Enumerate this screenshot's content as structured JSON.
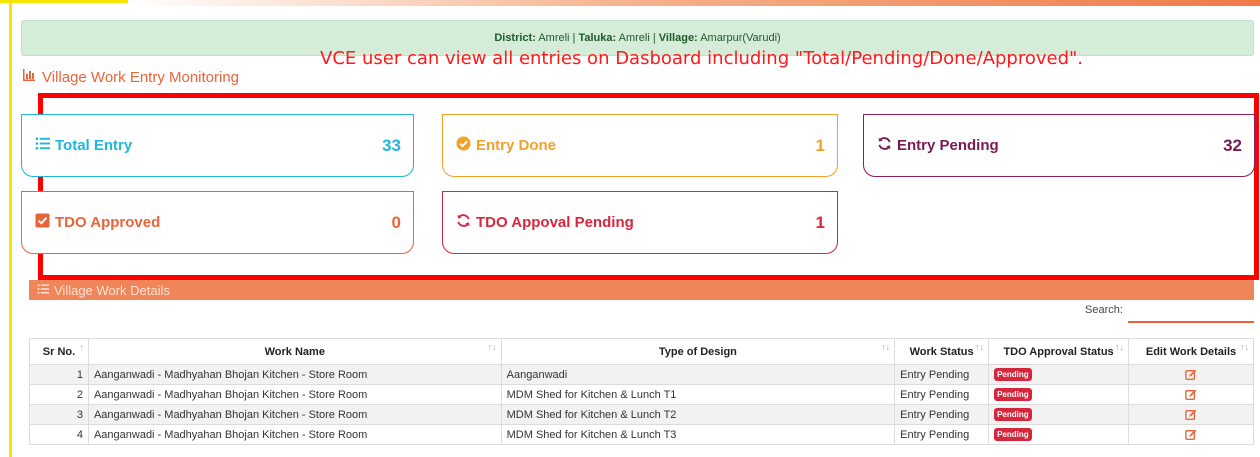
{
  "location": {
    "district_label": "District:",
    "district": "Amreli",
    "taluka_label": "Taluka:",
    "taluka": "Amreli",
    "village_label": "Village:",
    "village": "Amarpur(Varudi)",
    "separator": " | "
  },
  "annotation_text": "VCE user can view all entries on Dasboard including \"Total/Pending/Done/Approved\".",
  "page_title": "Village Work Entry Monitoring",
  "cards": {
    "total": {
      "label": "Total Entry",
      "value": "33"
    },
    "done": {
      "label": "Entry Done",
      "value": "1"
    },
    "pending": {
      "label": "Entry Pending",
      "value": "32"
    },
    "tdo_approved": {
      "label": "TDO Approved",
      "value": "0"
    },
    "tdo_pending": {
      "label": "TDO Appoval Pending",
      "value": "1"
    }
  },
  "details_title": "Village Work Details",
  "search": {
    "label": "Search:",
    "value": ""
  },
  "table": {
    "headers": {
      "sr": "Sr No.",
      "name": "Work Name",
      "design": "Type of Design",
      "status": "Work Status",
      "tdo": "TDO Approval Status",
      "edit": "Edit Work Details"
    },
    "rows": [
      {
        "sr": "1",
        "name": "Aanganwadi - Madhyahan Bhojan Kitchen - Store Room",
        "design": "Aanganwadi",
        "status": "Entry Pending",
        "tdo": "Pending"
      },
      {
        "sr": "2",
        "name": "Aanganwadi - Madhyahan Bhojan Kitchen - Store Room",
        "design": "MDM Shed for Kitchen & Lunch T1",
        "status": "Entry Pending",
        "tdo": "Pending"
      },
      {
        "sr": "3",
        "name": "Aanganwadi - Madhyahan Bhojan Kitchen - Store Room",
        "design": "MDM Shed for Kitchen & Lunch T2",
        "status": "Entry Pending",
        "tdo": "Pending"
      },
      {
        "sr": "4",
        "name": "Aanganwadi - Madhyahan Bhojan Kitchen - Store Room",
        "design": "MDM Shed for Kitchen & Lunch T3",
        "status": "Entry Pending",
        "tdo": "Pending"
      }
    ]
  },
  "colors": {
    "accent": "#e8643a",
    "total": "#1fb6da",
    "done": "#f0a12a",
    "pending": "#7a1a52",
    "tdo_pending": "#d7263d",
    "annotation": "#ff1a1a"
  },
  "icons": {
    "title": "bar-chart-icon",
    "total": "list-icon",
    "done": "check-circle-icon",
    "pending": "sync-icon",
    "tdo_approved": "check-square-icon",
    "tdo_pending": "sync-icon",
    "details": "list-icon",
    "edit": "edit-icon"
  }
}
